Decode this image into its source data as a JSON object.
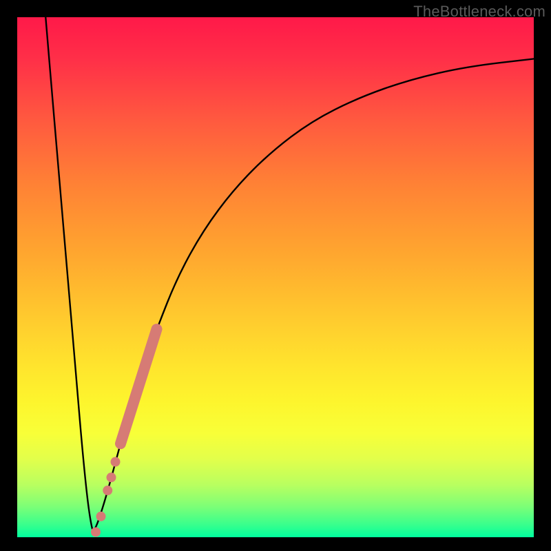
{
  "watermark": {
    "text": "TheBottleneck.com"
  },
  "colors": {
    "background_black": "#000000",
    "curve_stroke": "#000000",
    "salmon_marker": "#d67b75"
  },
  "chart_data": {
    "type": "line",
    "title": "",
    "xlabel": "",
    "ylabel": "",
    "xlim": [
      0,
      100
    ],
    "ylim": [
      0,
      100
    ],
    "grid": false,
    "legend": false,
    "series": [
      {
        "name": "left-descent",
        "x": [
          5.5,
          6.6,
          7.8,
          9.0,
          10.2,
          11.4,
          12.5,
          13.5,
          14.2,
          14.8
        ],
        "values": [
          100,
          87,
          73,
          59,
          45,
          31,
          18,
          8,
          3,
          0.5
        ]
      },
      {
        "name": "right-saturating-curve",
        "x": [
          14.8,
          17,
          20,
          23,
          27,
          31,
          36,
          42,
          49,
          57,
          66,
          76,
          87,
          100
        ],
        "values": [
          0.5,
          7,
          18,
          29,
          40,
          50,
          59,
          67,
          74,
          80,
          84.5,
          88,
          90.5,
          92
        ]
      }
    ],
    "annotations": [
      {
        "name": "salmon-thick-segment",
        "shape": "round-line",
        "x": [
          20.0,
          27.0
        ],
        "values": [
          18.0,
          40.0
        ],
        "color": "#d67b75"
      },
      {
        "name": "salmon-dots",
        "shape": "dots",
        "points": [
          {
            "x": 17.5,
            "y": 9.0
          },
          {
            "x": 18.2,
            "y": 11.5
          },
          {
            "x": 19.0,
            "y": 14.5
          },
          {
            "x": 16.2,
            "y": 4.0
          },
          {
            "x": 15.2,
            "y": 1.0
          }
        ],
        "color": "#d67b75"
      }
    ],
    "background_gradient": {
      "orientation": "vertical",
      "stops": [
        {
          "pos": 0.0,
          "color": "#ff1949"
        },
        {
          "pos": 0.45,
          "color": "#ffa52f"
        },
        {
          "pos": 0.74,
          "color": "#fdf52d"
        },
        {
          "pos": 1.0,
          "color": "#00ff9e"
        }
      ]
    }
  }
}
